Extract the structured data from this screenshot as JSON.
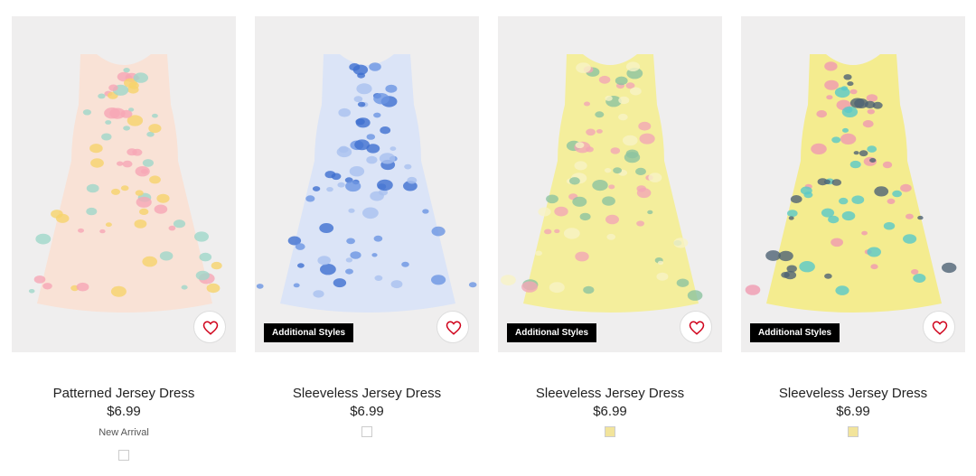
{
  "products": [
    {
      "name": "Patterned Jersey Dress",
      "price": "$6.99",
      "tag": "New Arrival",
      "badge": "",
      "favorite_icon": "heart-outline-icon",
      "swatch_color": "#ffffff",
      "dress": {
        "base": "#f9e2d6",
        "accent1": "#f6a6b5",
        "accent2": "#9fd7c9",
        "accent3": "#f6d36b"
      }
    },
    {
      "name": "Sleeveless Jersey Dress",
      "price": "$6.99",
      "tag": "",
      "badge": "Additional Styles",
      "favorite_icon": "heart-outline-icon",
      "swatch_color": "#ffffff",
      "dress": {
        "base": "#dbe4f7",
        "accent1": "#3f6fcf",
        "accent2": "#6b95e2",
        "accent3": "#a9c0ef"
      }
    },
    {
      "name": "Sleeveless Jersey Dress",
      "price": "$6.99",
      "tag": "",
      "badge": "Additional Styles",
      "favorite_icon": "heart-outline-icon",
      "swatch_color": "#f2e49b",
      "dress": {
        "base": "#f4ee9c",
        "accent1": "#f2a6b5",
        "accent2": "#8cc3a0",
        "accent3": "#f7f3c6"
      }
    },
    {
      "name": "Sleeveless Jersey Dress",
      "price": "$6.99",
      "tag": "",
      "badge": "Additional Styles",
      "favorite_icon": "heart-outline-icon",
      "swatch_color": "#f2e49b",
      "dress": {
        "base": "#f4ec8f",
        "accent1": "#59c9c8",
        "accent2": "#f09ab0",
        "accent3": "#4f6374"
      }
    }
  ],
  "colors": {
    "heart_red": "#d0021b",
    "badge_bg": "#000000"
  }
}
